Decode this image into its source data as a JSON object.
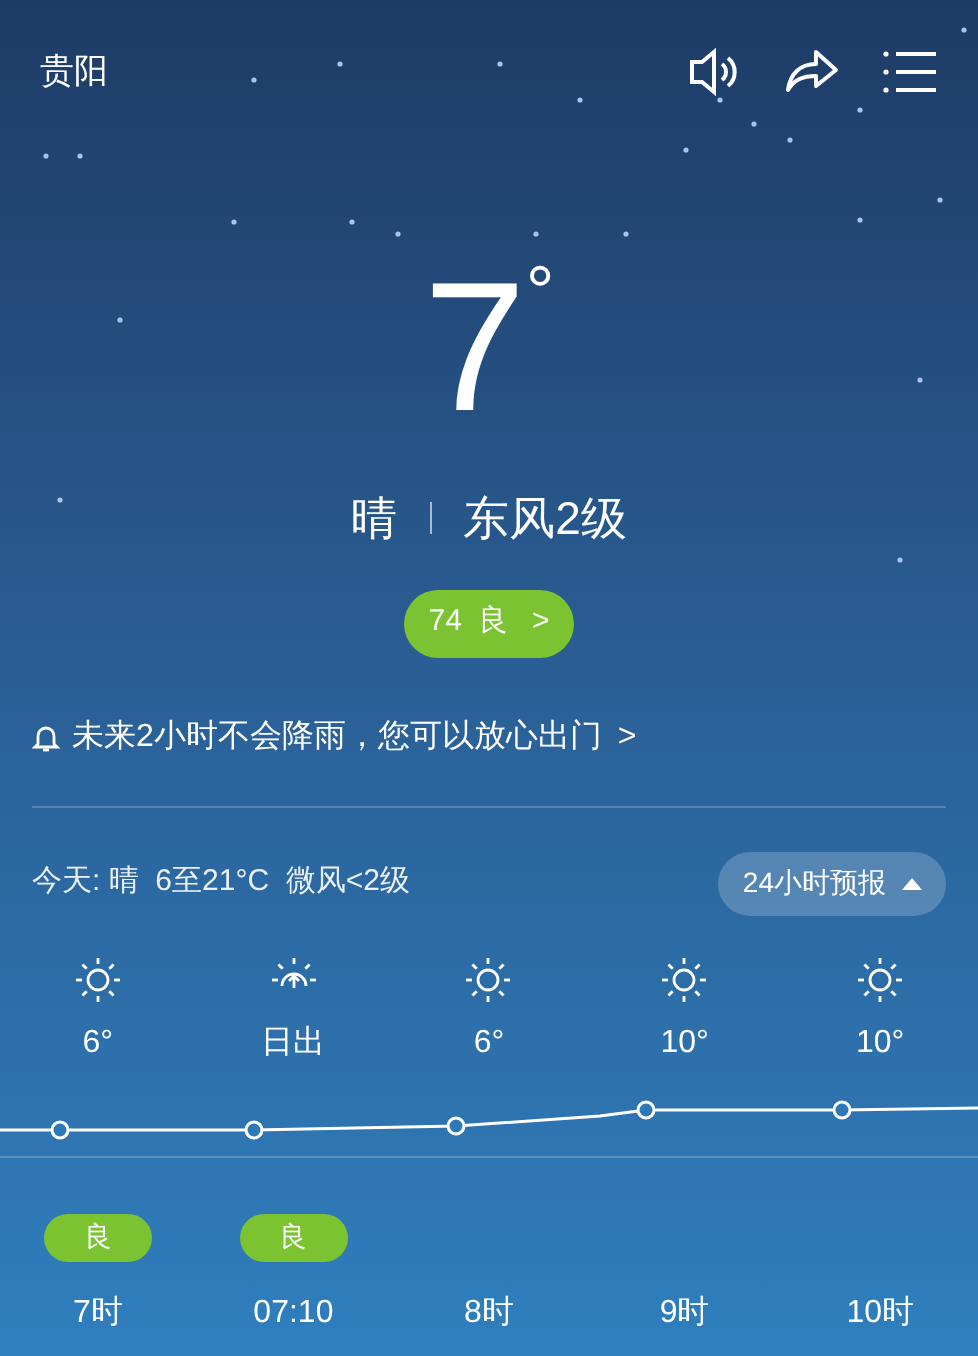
{
  "header": {
    "city": "贵阳"
  },
  "current": {
    "temperature": "7",
    "degree": "°",
    "condition": "晴",
    "wind": "东风2级",
    "aqi": {
      "value": "74",
      "level": "良",
      "arrow": ">"
    }
  },
  "alert": {
    "text": "未来2小时不会降雨，您可以放心出门",
    "arrow": ">"
  },
  "today": {
    "summary": "今天: 晴  6至21°C  微风<2级",
    "forecast_button": {
      "label": "24小时预报",
      "expanded": true
    }
  },
  "hourly": [
    {
      "kind": "sun",
      "value": "6°",
      "aqi": "良",
      "time": "7时"
    },
    {
      "kind": "sunrise",
      "value": "日出",
      "aqi": "良",
      "time": "07:10"
    },
    {
      "kind": "sun",
      "value": "6°",
      "time": "8时"
    },
    {
      "kind": "sun",
      "value": "10°",
      "time": "9时"
    },
    {
      "kind": "sun",
      "value": "10°",
      "time": "10时"
    }
  ]
}
